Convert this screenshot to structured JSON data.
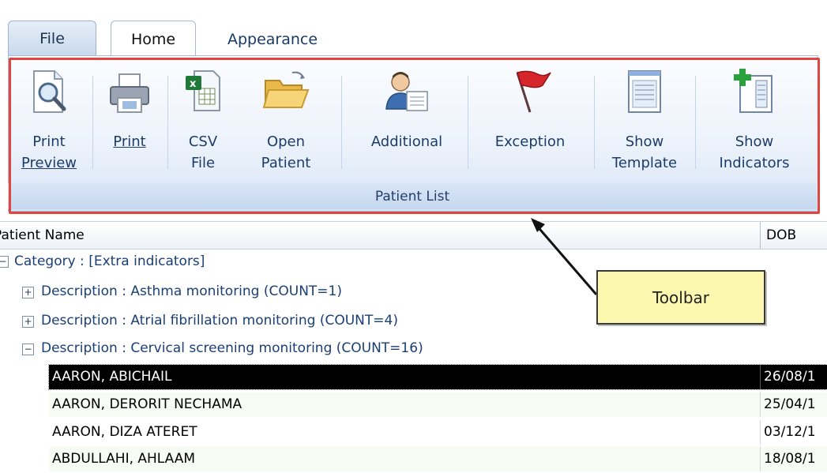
{
  "tabs": {
    "file": "File",
    "home": "Home",
    "appearance": "Appearance"
  },
  "ribbon": {
    "group_label": "Patient List",
    "buttons": [
      {
        "line1": "Print",
        "line2": "Preview",
        "icon": "magnifier-page-icon"
      },
      {
        "line1": "Print",
        "line2": "",
        "icon": "printer-icon"
      },
      {
        "line1": "CSV",
        "line2": "File",
        "icon": "excel-csv-icon"
      },
      {
        "line1": "Open",
        "line2": "Patient",
        "icon": "open-folder-icon"
      },
      {
        "line1": "Additional",
        "line2": "",
        "icon": "person-card-icon"
      },
      {
        "line1": "Exception",
        "line2": "",
        "icon": "red-flag-icon"
      },
      {
        "line1": "Show",
        "line2": "Template",
        "icon": "template-doc-icon"
      },
      {
        "line1": "Show",
        "line2": "Indicators",
        "icon": "add-indicators-icon"
      }
    ]
  },
  "grid": {
    "headers": {
      "name": "Patient Name",
      "dob": "DOB"
    },
    "category": "Category : [Extra indicators]",
    "descriptions": [
      "Description : Asthma monitoring (COUNT=1)",
      "Description : Atrial fibrillation monitoring (COUNT=4)",
      "Description : Cervical screening monitoring (COUNT=16)"
    ],
    "patients": [
      {
        "name": "AARON, ABICHAIL",
        "dob": "26/08/1"
      },
      {
        "name": "AARON, DERORIT NECHAMA",
        "dob": "25/04/1"
      },
      {
        "name": "AARON, DIZA ATERET",
        "dob": "03/12/1"
      },
      {
        "name": "ABDULLAHI, AHLAAM",
        "dob": "18/08/1"
      }
    ]
  },
  "annotation": {
    "callout_text": "Toolbar"
  },
  "colors": {
    "highlight": "#e0453f",
    "callout_bg": "#fdf8b0",
    "selected_row": "#000000"
  }
}
